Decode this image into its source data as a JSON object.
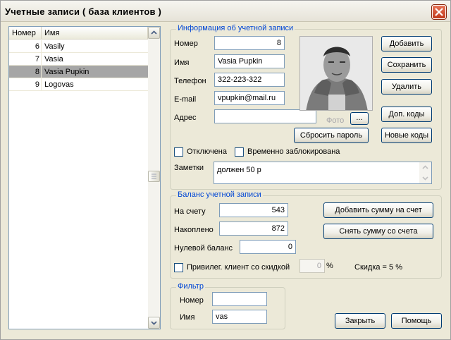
{
  "window": {
    "title": "Учетные записи ( база клиентов )"
  },
  "list": {
    "columns": [
      "Номер",
      "Имя"
    ],
    "rows": [
      {
        "num": "6",
        "name": "Vasily"
      },
      {
        "num": "7",
        "name": "Vasia"
      },
      {
        "num": "8",
        "name": "Vasia Pupkin",
        "selected": true
      },
      {
        "num": "9",
        "name": "Logovas"
      }
    ]
  },
  "account": {
    "legend": "Информация об учетной записи",
    "number_label": "Номер",
    "number_value": "8",
    "name_label": "Имя",
    "name_value": "Vasia Pupkin",
    "phone_label": "Телефон",
    "phone_value": "322-223-322",
    "email_label": "E-mail",
    "email_value": "vpupkin@mail.ru",
    "address_label": "Адрес",
    "address_value": "",
    "photo_label": "Фото",
    "photo_browse": "...",
    "reset_password": "Сбросить пароль",
    "disabled_label": "Отключена",
    "blocked_label": "Временно заблокирована",
    "notes_label": "Заметки",
    "notes_value": "должен 50 р"
  },
  "actions": {
    "add": "Добавить",
    "save": "Сохранить",
    "delete": "Удалить",
    "extra_codes": "Доп. коды",
    "new_codes": "Новые коды"
  },
  "balance": {
    "legend": "Баланс учетной записи",
    "on_account_label": "На счету",
    "on_account_value": "543",
    "accumulated_label": "Накоплено",
    "accumulated_value": "872",
    "zero_balance_label": "Нулевой баланс",
    "zero_balance_value": "0",
    "privileged_label": "Привилег. клиент со скидкой",
    "discount_value": "0",
    "discount_unit": "%",
    "discount_text": "Скидка = 5 %",
    "add_sum": "Добавить сумму на счет",
    "withdraw_sum": "Снять сумму со счета"
  },
  "filter": {
    "legend": "Фильтр",
    "number_label": "Номер",
    "number_value": "",
    "name_label": "Имя",
    "name_value": "vas"
  },
  "footer": {
    "close": "Закрыть",
    "help": "Помощь"
  },
  "icons": {
    "close": "close-icon",
    "scroll_up": "scroll-up-arrow-icon",
    "scroll_down": "scroll-down-arrow-icon",
    "photo": "user-photo"
  }
}
